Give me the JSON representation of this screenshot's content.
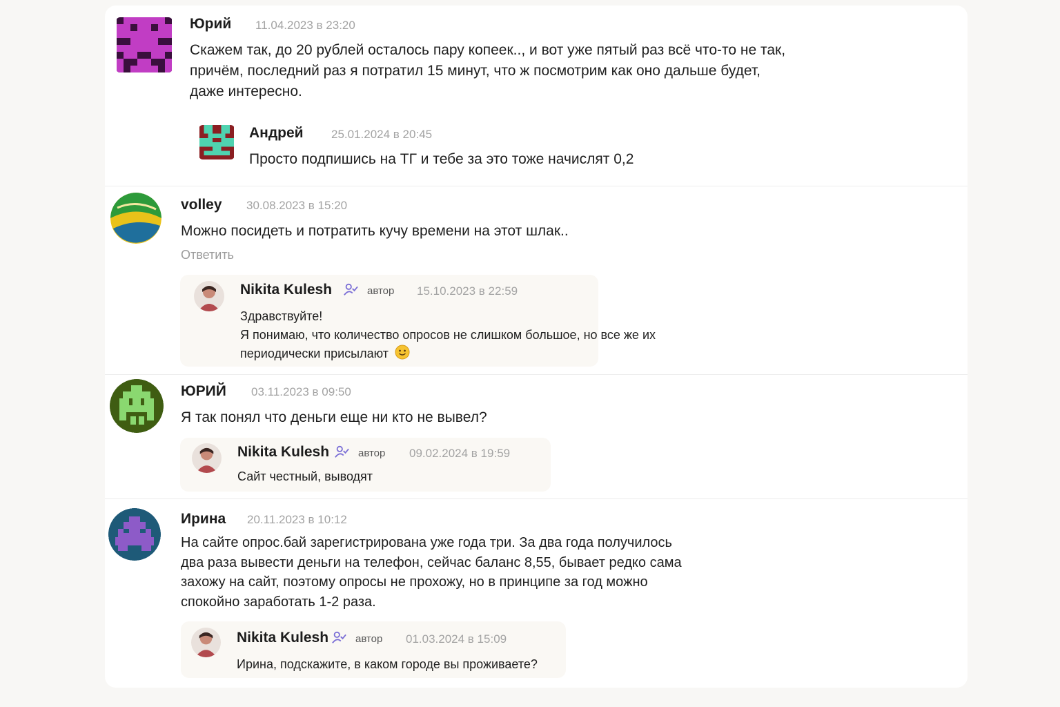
{
  "comments": [
    {
      "name": "Юрий",
      "date": "11.04.2023 в 23:20",
      "text": "Скажем так, до 20 рублей осталось пару копеек.., и вот уже пятый раз всё что-то не так, причём, последний раз я потратил 15 минут, что ж посмотрим как оно дальше будет, даже интересно.",
      "reply": {
        "name": "Андрей",
        "date": "25.01.2024 в 20:45",
        "text": "Просто подпишись на ТГ и тебе за это тоже начислят 0,2"
      }
    },
    {
      "name": "volley",
      "date": "30.08.2023 в 15:20",
      "text": "Можно посидеть и потратить кучу времени на этот шлак..",
      "reply_link": "Ответить",
      "reply": {
        "name": "Nikita Kulesh",
        "badge": "автор",
        "date": "15.10.2023 в 22:59",
        "line1": "Здравствуйте!",
        "line2": "Я понимаю, что количество опросов не слишком большое, но все же их",
        "line3": "периодически присылают"
      }
    },
    {
      "name": "ЮРИЙ",
      "date": "03.11.2023 в 09:50",
      "text": "Я так понял что деньги еще ни кто не вывел?",
      "reply": {
        "name": "Nikita Kulesh",
        "badge": "автор",
        "date": "09.02.2024 в 19:59",
        "text": "Сайт честный, выводят"
      }
    },
    {
      "name": "Ирина",
      "date": "20.11.2023 в 10:12",
      "text": "На сайте опрос.бай зарегистрирована уже года три. За два года получилось два раза вывести деньги на телефон, сейчас баланс 8,55, бывает редко сама захожу на сайт, поэтому опросы не прохожу, но в принципе за год можно спокойно заработать 1-2 раза.",
      "reply": {
        "name": "Nikita Kulesh",
        "badge": "автор",
        "date": "01.03.2024 в 15:09",
        "text": "Ирина, подскажите, в каком городе вы проживаете?"
      }
    }
  ],
  "colors": {
    "accent_author": "#7b6fd6",
    "avatar_magenta": "#c13dc4",
    "avatar_red": "#8b1e22",
    "avatar_teal": "#4fd3b0",
    "avatar_green": "#3f5d12",
    "avatar_purple": "#8d5bc8"
  }
}
